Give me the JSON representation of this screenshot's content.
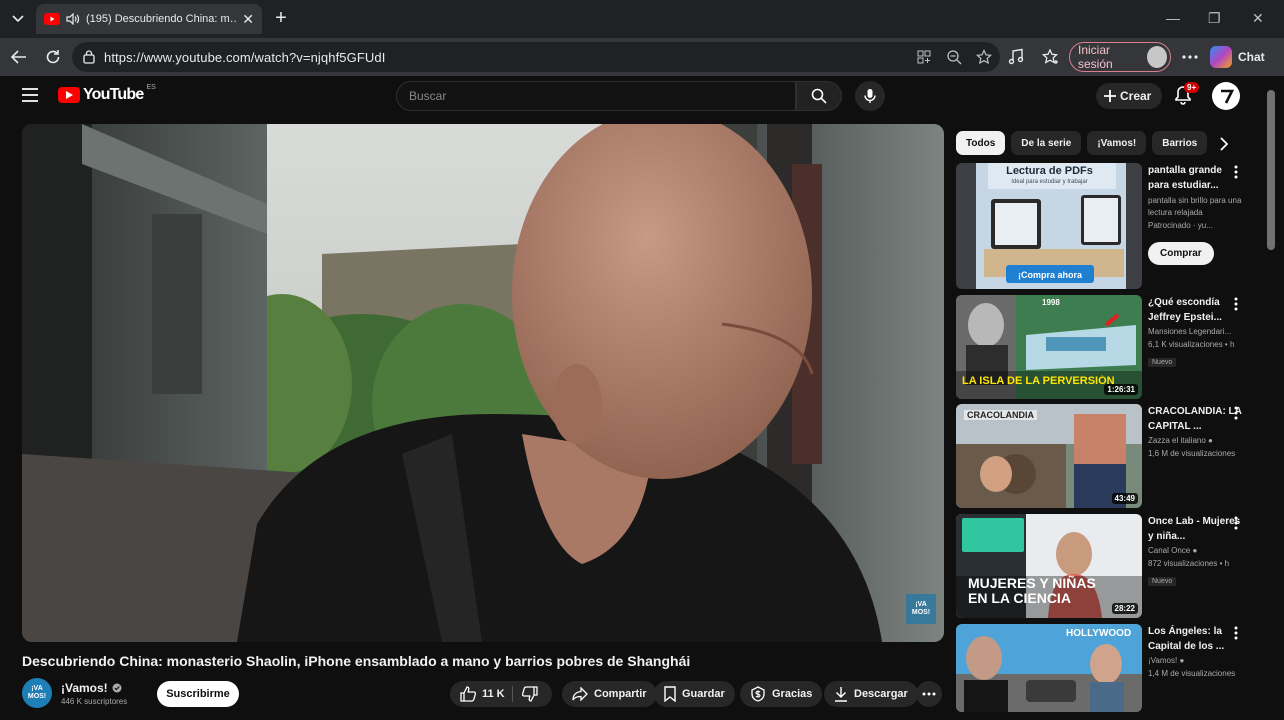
{
  "browser": {
    "tab_title": "(195) Descubriendo China: m…",
    "url": "https://www.youtube.com/watch?v=njqhf5GFUdI",
    "signin_label": "Iniciar sesión",
    "chat_label": "Chat"
  },
  "header": {
    "logo_text": "YouTube",
    "country_code": "ES",
    "search_placeholder": "Buscar",
    "create_label": "Crear",
    "notif_count": "9+"
  },
  "video": {
    "title": "Descubriendo China: monasterio Shaolin, iPhone ensamblado a mano y barrios pobres de Shanghái",
    "watermark": "¡VA MOS!",
    "channel_name": "¡Vamos!",
    "channel_avatar_text": "¡VA MOS!",
    "subscribers": "446 K suscriptores",
    "subscribe_label": "Suscribirme",
    "likes": "11 K",
    "share_label": "Compartir",
    "save_label": "Guardar",
    "thanks_label": "Gracias",
    "download_label": "Descargar"
  },
  "chips": [
    "Todos",
    "De la serie",
    "¡Vamos!",
    "Barrios"
  ],
  "ad": {
    "title": "pantalla grande para estudiar...",
    "desc": "pantalla sin brillo para una lectura relajada",
    "sponsor": "Patrocinado · yu...",
    "cta": "Comprar",
    "thumb_heading": "Lectura de PDFs",
    "thumb_sub": "Ideal para estudiar y trabajar",
    "thumb_cta": "¡Compra ahora"
  },
  "recommendations": [
    {
      "title": "¿Qué escondía Jeffrey Epstei...",
      "channel": "Mansiones Legendari...",
      "views": "6,1 K visualizaciones • h",
      "badge": "Nuevo",
      "duration": "1:26:31",
      "overlay": "LA ISLA DE LA PERVERSIÓN",
      "year": "1998"
    },
    {
      "title": "CRACOLANDIA: LA CAPITAL ...",
      "channel": "Zazza el italiano",
      "views": "1,6 M de visualizaciones",
      "badge": "",
      "duration": "43:49",
      "overlay": "CRACOLANDIA",
      "year": ""
    },
    {
      "title": "Once Lab - Mujeres y niña...",
      "channel": "Canal Once",
      "views": "872 visualizaciones • h",
      "badge": "Nuevo",
      "duration": "28:22",
      "overlay": "MUJERES Y NIÑAS EN LA CIENCIA",
      "year": ""
    },
    {
      "title": "Los Ángeles: la Capital de los ...",
      "channel": "¡Vamos!",
      "views": "1,4 M de visualizaciones",
      "badge": "",
      "duration": "",
      "overlay": "HOLLYWOOD",
      "year": ""
    }
  ]
}
